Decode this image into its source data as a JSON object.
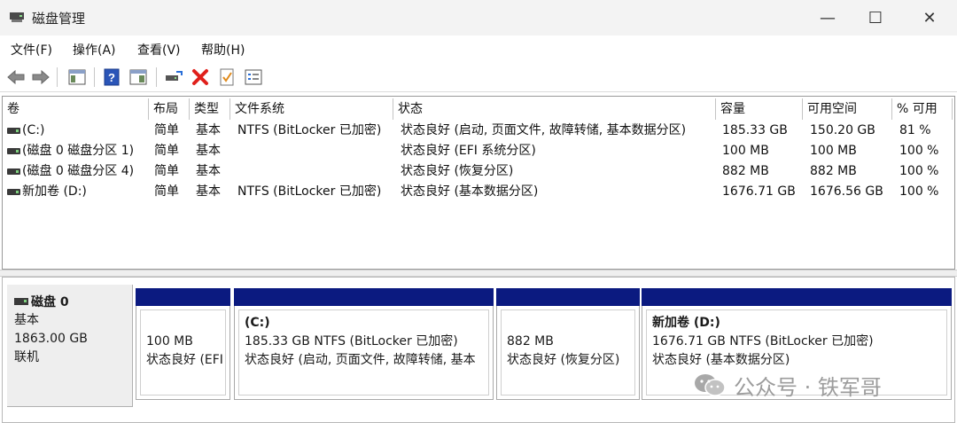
{
  "window": {
    "title": "磁盘管理",
    "controls": {
      "minimize": "—",
      "maximize": "☐",
      "close": "✕"
    }
  },
  "menu": [
    "文件(F)",
    "操作(A)",
    "查看(V)",
    "帮助(H)"
  ],
  "toolbar": {
    "icons": [
      "back-icon",
      "forward-icon",
      "console-tree-icon",
      "help-icon",
      "properties-icon",
      "connect-disk-icon",
      "delete-icon",
      "check-icon",
      "properties-list-icon"
    ]
  },
  "volume_table": {
    "columns": [
      "卷",
      "布局",
      "类型",
      "文件系统",
      "状态",
      "容量",
      "可用空间",
      "% 可用"
    ],
    "rows": [
      {
        "volume": "(C:)",
        "layout": "简单",
        "type": "基本",
        "fs": "NTFS (BitLocker 已加密)",
        "status": "状态良好 (启动, 页面文件, 故障转储, 基本数据分区)",
        "capacity": "185.33 GB",
        "free": "150.20 GB",
        "pct": "81 %"
      },
      {
        "volume": "(磁盘 0 磁盘分区 1)",
        "layout": "简单",
        "type": "基本",
        "fs": "",
        "status": "状态良好 (EFI 系统分区)",
        "capacity": "100 MB",
        "free": "100 MB",
        "pct": "100 %"
      },
      {
        "volume": "(磁盘 0 磁盘分区 4)",
        "layout": "简单",
        "type": "基本",
        "fs": "",
        "status": "状态良好 (恢复分区)",
        "capacity": "882 MB",
        "free": "882 MB",
        "pct": "100 %"
      },
      {
        "volume": "新加卷 (D:)",
        "layout": "简单",
        "type": "基本",
        "fs": "NTFS (BitLocker 已加密)",
        "status": "状态良好 (基本数据分区)",
        "capacity": "1676.71 GB",
        "free": "1676.56 GB",
        "pct": "100 %"
      }
    ]
  },
  "disk": {
    "name": "磁盘 0",
    "type": "基本",
    "size": "1863.00 GB",
    "state": "联机",
    "partitions": [
      {
        "name": "",
        "line1": "100 MB",
        "line2": "状态良好 (EFI"
      },
      {
        "name": "(C:)",
        "line1": "185.33 GB NTFS (BitLocker 已加密)",
        "line2": "状态良好 (启动, 页面文件, 故障转储, 基本"
      },
      {
        "name": "",
        "line1": "882 MB",
        "line2": "状态良好 (恢复分区)"
      },
      {
        "name": "新加卷  (D:)",
        "line1": "1676.71 GB NTFS (BitLocker 已加密)",
        "line2": "状态良好 (基本数据分区)"
      }
    ]
  },
  "watermark": "公众号 · 铁军哥",
  "colors": {
    "partition_bar": "#0b1a80",
    "delete_red": "#e0201b"
  }
}
